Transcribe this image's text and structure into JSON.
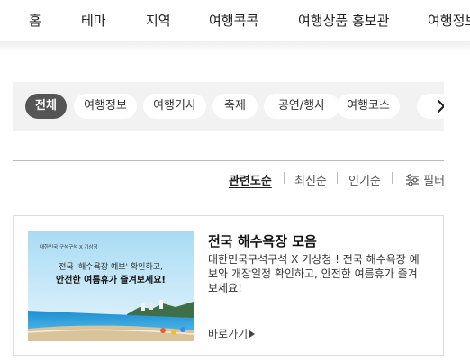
{
  "nav": {
    "items": [
      {
        "label": "홈"
      },
      {
        "label": "테마"
      },
      {
        "label": "지역"
      },
      {
        "label": "여행콕콕"
      },
      {
        "label": "여행상품 홍보관"
      },
      {
        "label": "여행정보"
      }
    ]
  },
  "filters": {
    "chips": [
      {
        "label": "전체",
        "active": true
      },
      {
        "label": "여행정보"
      },
      {
        "label": "여행기사"
      },
      {
        "label": "축제"
      },
      {
        "label": "공연/행사"
      },
      {
        "label": "여행코스"
      }
    ],
    "scroll_icon": "chevron-right-icon"
  },
  "sort": {
    "options": [
      {
        "label": "관련도순",
        "active": true
      },
      {
        "label": "최신순"
      },
      {
        "label": "인기순"
      }
    ],
    "filter_label": "필터",
    "filter_icon": "sliders-icon"
  },
  "result": {
    "title": "전국 해수욕장 모음",
    "description": "대한민국구석구석 X 기상청 ! 전국 해수욕장 예보와 개장일정 확인하고, 안전한 여름휴가 즐겨보세요!",
    "more_label": "바로가기",
    "thumbnail": {
      "brand": "대한민국 구석구석 X 기상청",
      "line1": "전국 '해수욕장 예보' 확인하고,",
      "line2": "안전한 여름휴가 즐겨보세요!"
    }
  },
  "colors": {
    "accent": "#555555",
    "sea": "#1f8fd0",
    "sky": "#bfe4f6"
  }
}
